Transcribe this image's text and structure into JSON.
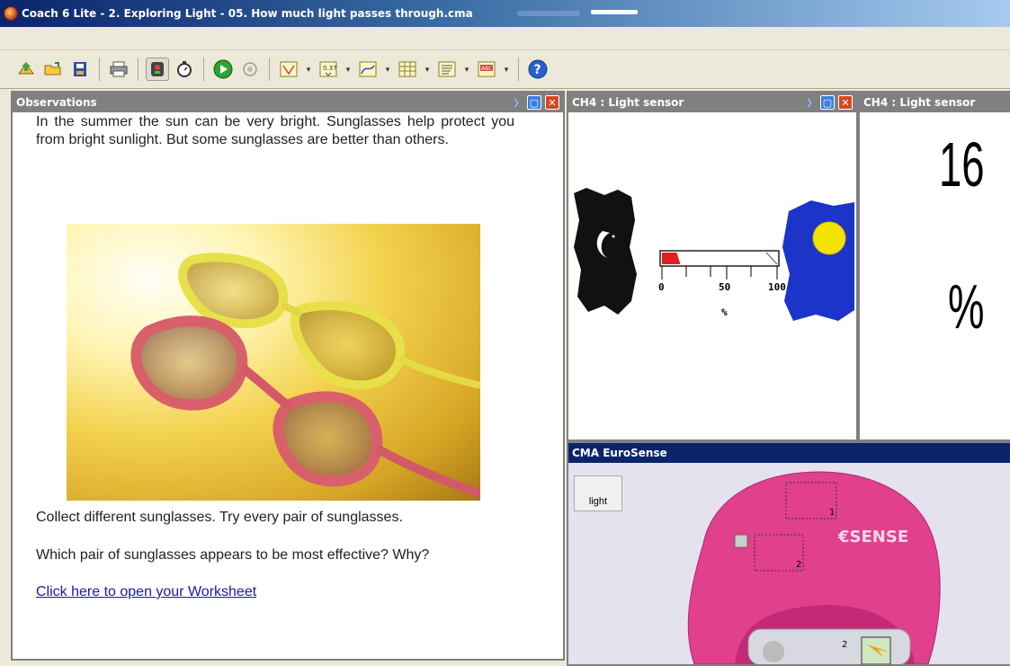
{
  "window": {
    "title": "Coach 6 Lite - 2. Exploring Light - 05. How much light passes through.cma"
  },
  "toolbar": {
    "buttons": [
      {
        "name": "open-activity-icon",
        "glyph": "📂"
      },
      {
        "name": "open-result-icon",
        "glyph": "📁"
      },
      {
        "name": "save-icon",
        "glyph": "💾"
      },
      {
        "name": "print-icon",
        "glyph": "🖨"
      },
      {
        "name": "sensor-icon",
        "glyph": "◐"
      },
      {
        "name": "stopwatch-icon",
        "glyph": "⏱"
      },
      {
        "name": "start-icon",
        "glyph": "▶"
      },
      {
        "name": "stop-icon",
        "glyph": "◎"
      },
      {
        "name": "meter-icon",
        "glyph": "▽"
      },
      {
        "name": "value-display-icon",
        "glyph": "▣"
      },
      {
        "name": "graph-icon",
        "glyph": "📈"
      },
      {
        "name": "table-icon",
        "glyph": "▦"
      },
      {
        "name": "text-icon",
        "glyph": "▤"
      },
      {
        "name": "abc-icon",
        "glyph": "▭"
      },
      {
        "name": "help-icon",
        "glyph": "?"
      }
    ]
  },
  "observations": {
    "title": "Observations",
    "paragraph1": "In the summer the sun can be very bright. Sunglasses help protect you from bright sunlight. But some sunglasses are better than others.",
    "paragraph2": "Collect different sunglasses. Try every pair of sunglasses.",
    "paragraph3": "Which pair of sunglasses appears to be most effective? Why?",
    "link": "Click here to open your Worksheet"
  },
  "light_meter": {
    "title": "CH4 : Light sensor",
    "ticks": [
      "0",
      "50",
      "100"
    ],
    "unit": "%",
    "level_percent": 16,
    "accent": "#e02020"
  },
  "digital_display": {
    "title": "CH4 : Light sensor",
    "value": "16",
    "unit": "%"
  },
  "eurosense": {
    "title": "CMA EuroSense",
    "sensor_label": "light",
    "port1": "1",
    "port2": "2",
    "port3": "2",
    "brand": "€SENSE",
    "device_color": "#e0408c"
  }
}
